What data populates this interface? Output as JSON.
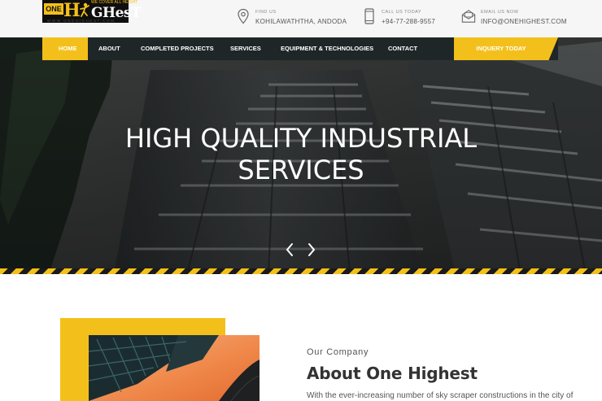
{
  "logo": {
    "one_text": "ONE",
    "h_text": "H",
    "rest_text": "GHesT",
    "tagline": "WE COVER ALL HEIGHT",
    "url": "WWW.ONEHIGHEST.COM"
  },
  "contacts": [
    {
      "icon": "map-pin-icon",
      "label": "FIND US",
      "value": "KOHILAWATHTHA, ANDODA"
    },
    {
      "icon": "phone-icon",
      "label": "CALL US TODAY",
      "value": "+94-77-288-9557"
    },
    {
      "icon": "envelope-icon",
      "label": "EMAIL US NOW",
      "value": "INFO@ONEHIGHEST.COM"
    }
  ],
  "nav": {
    "items": [
      "HOME",
      "ABOUT",
      "COMPLETED PROJECTS",
      "SERVICES",
      "EQUIPMENT & TECHNOLOGIES",
      "CONTACT"
    ],
    "active_index": 0,
    "cta": "INQUERY TODAY"
  },
  "hero": {
    "title_line1": "HIGH QUALITY INDUSTRIAL",
    "title_line2": "SERVICES",
    "prev_label": "‹",
    "next_label": "›"
  },
  "about": {
    "subtitle": "Our Company",
    "title": "About One Highest",
    "text": "With the ever-increasing number of sky scraper constructions in the city of"
  },
  "colors": {
    "accent": "#f3c01b",
    "nav_bg": "#1f2628",
    "header_bg": "#f6f6f6"
  }
}
